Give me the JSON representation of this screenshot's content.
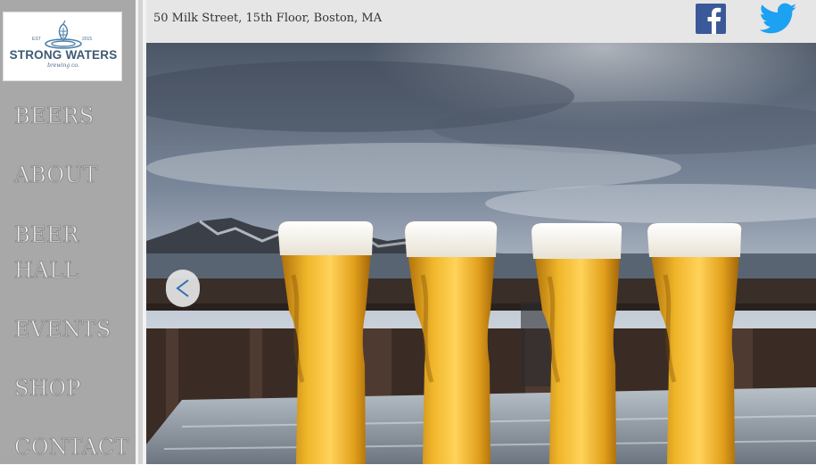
{
  "brand": {
    "name": "STRONG WATERS",
    "tagline": "brewing co.",
    "est_label": "EST",
    "year": "2015"
  },
  "nav": {
    "items": [
      {
        "label": "BEERS"
      },
      {
        "label": "ABOUT"
      },
      {
        "label": "BEER"
      },
      {
        "label": "HALL"
      },
      {
        "label": "EVENTS"
      },
      {
        "label": "SHOP"
      },
      {
        "label": "CONTACT"
      }
    ]
  },
  "header": {
    "address": "50 Milk Street, 15th Floor, Boston, MA",
    "social": [
      {
        "icon": "facebook-icon",
        "color": "#3b5998"
      },
      {
        "icon": "twitter-icon",
        "color": "#1da1f2"
      }
    ]
  },
  "hero": {
    "icon": "chevron-left-icon",
    "arrow_color": "#2e6fb7"
  }
}
